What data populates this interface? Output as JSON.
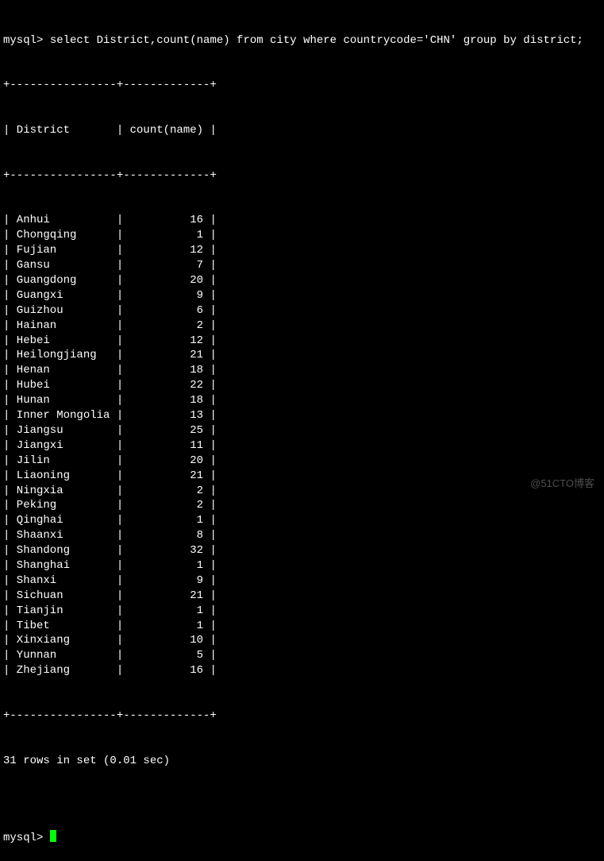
{
  "prompt_text": "mysql> ",
  "query": "select District,count(name) from city where countrycode='CHN' group by district;",
  "table": {
    "separator": "+----------------+-------------+",
    "header_row": "| District       | count(name) |",
    "columns": [
      "District",
      "count(name)"
    ],
    "col1_width": 14,
    "col2_width": 11,
    "rows": [
      {
        "district": "Anhui",
        "count": 16
      },
      {
        "district": "Chongqing",
        "count": 1
      },
      {
        "district": "Fujian",
        "count": 12
      },
      {
        "district": "Gansu",
        "count": 7
      },
      {
        "district": "Guangdong",
        "count": 20
      },
      {
        "district": "Guangxi",
        "count": 9
      },
      {
        "district": "Guizhou",
        "count": 6
      },
      {
        "district": "Hainan",
        "count": 2
      },
      {
        "district": "Hebei",
        "count": 12
      },
      {
        "district": "Heilongjiang",
        "count": 21
      },
      {
        "district": "Henan",
        "count": 18
      },
      {
        "district": "Hubei",
        "count": 22
      },
      {
        "district": "Hunan",
        "count": 18
      },
      {
        "district": "Inner Mongolia",
        "count": 13
      },
      {
        "district": "Jiangsu",
        "count": 25
      },
      {
        "district": "Jiangxi",
        "count": 11
      },
      {
        "district": "Jilin",
        "count": 20
      },
      {
        "district": "Liaoning",
        "count": 21
      },
      {
        "district": "Ningxia",
        "count": 2
      },
      {
        "district": "Peking",
        "count": 2
      },
      {
        "district": "Qinghai",
        "count": 1
      },
      {
        "district": "Shaanxi",
        "count": 8
      },
      {
        "district": "Shandong",
        "count": 32
      },
      {
        "district": "Shanghai",
        "count": 1
      },
      {
        "district": "Shanxi",
        "count": 9
      },
      {
        "district": "Sichuan",
        "count": 21
      },
      {
        "district": "Tianjin",
        "count": 1
      },
      {
        "district": "Tibet",
        "count": 1
      },
      {
        "district": "Xinxiang",
        "count": 10
      },
      {
        "district": "Yunnan",
        "count": 5
      },
      {
        "district": "Zhejiang",
        "count": 16
      }
    ]
  },
  "result_text": "31 rows in set (0.01 sec)",
  "blank_line": "",
  "next_prompt": "mysql> ",
  "watermark": "@51CTO博客"
}
